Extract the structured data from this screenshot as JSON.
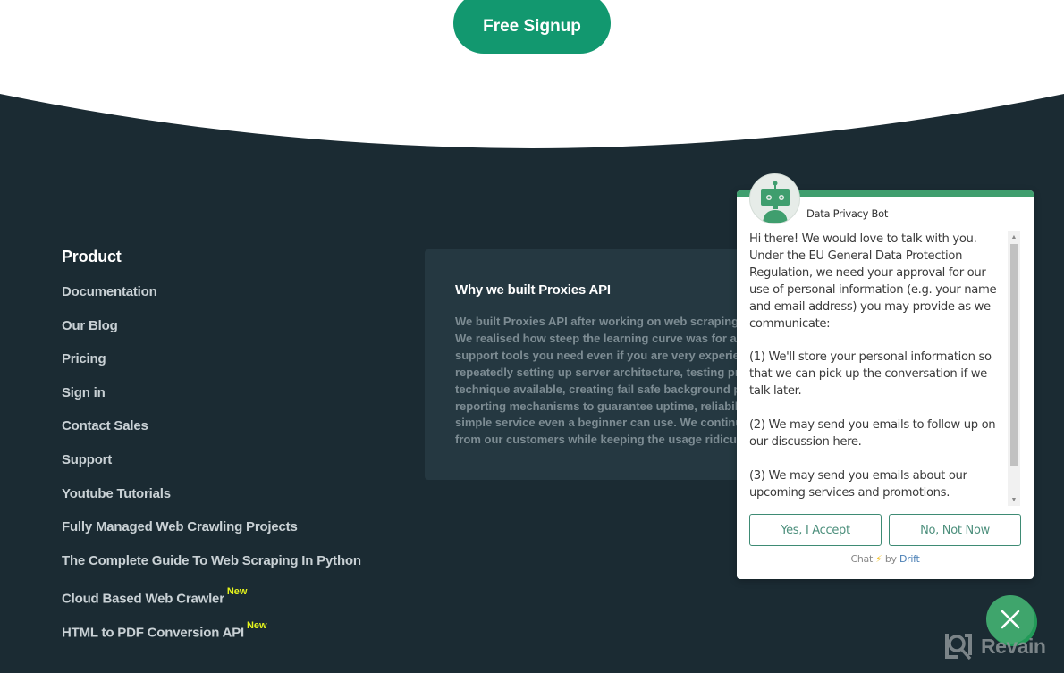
{
  "hero": {
    "signup_label": "Free Signup"
  },
  "colors": {
    "brand_green": "#12986f",
    "footer_bg": "#1b2b33",
    "card_bg": "#253841",
    "badge_new": "#e6f51c",
    "bot_green": "#3f9e6e"
  },
  "footer": {
    "product": {
      "heading": "Product",
      "links": [
        {
          "label": "Documentation",
          "badge": ""
        },
        {
          "label": "Our Blog",
          "badge": ""
        },
        {
          "label": "Pricing",
          "badge": ""
        },
        {
          "label": "Sign in",
          "badge": ""
        },
        {
          "label": "Contact Sales",
          "badge": ""
        },
        {
          "label": "Support",
          "badge": ""
        },
        {
          "label": "Youtube Tutorials",
          "badge": ""
        },
        {
          "label": "Fully Managed Web Crawling Projects",
          "badge": ""
        },
        {
          "label": "The Complete Guide To Web Scraping In Python",
          "badge": ""
        },
        {
          "label": "Cloud Based Web Crawler",
          "badge": "New"
        },
        {
          "label": "HTML to PDF Conversion API",
          "badge": "New"
        }
      ]
    },
    "why": {
      "heading": "Why we built Proxies API",
      "lines": [
        "We built Proxies API after working on web scraping",
        "We realised how steep the learning curve was for a",
        "support tools you need even if you are very experien",
        "repeatedly setting up server architecture, testing pro",
        "technique available, creating fail safe background pr",
        "reporting mechanisms to guarantee uptime, reliabilit",
        "simple service even a beginner can use. We continu",
        "from our customers while keeping the usage ridiculo"
      ]
    }
  },
  "chat": {
    "bot_name": "Data Privacy Bot",
    "avatar_icon": "robot-icon",
    "message": [
      "Hi there! We would love to talk with you. Under the EU General Data Protection Regulation, we need your approval for our use of personal information (e.g. your name and email address) you may provide as we communicate:",
      "(1) We'll store your personal information so that we can pick up the conversation if we talk later.",
      "(2) We may send you emails to follow up on our discussion here.",
      "(3) We may send you emails about our upcoming services and promotions."
    ],
    "accept_label": "Yes, I Accept",
    "decline_label": "No, Not Now",
    "powered_prefix": "Chat",
    "powered_bolt": "⚡",
    "powered_by": "by",
    "powered_brand": "Drift",
    "close_icon": "close-icon"
  },
  "watermark": {
    "text": "Revain"
  }
}
